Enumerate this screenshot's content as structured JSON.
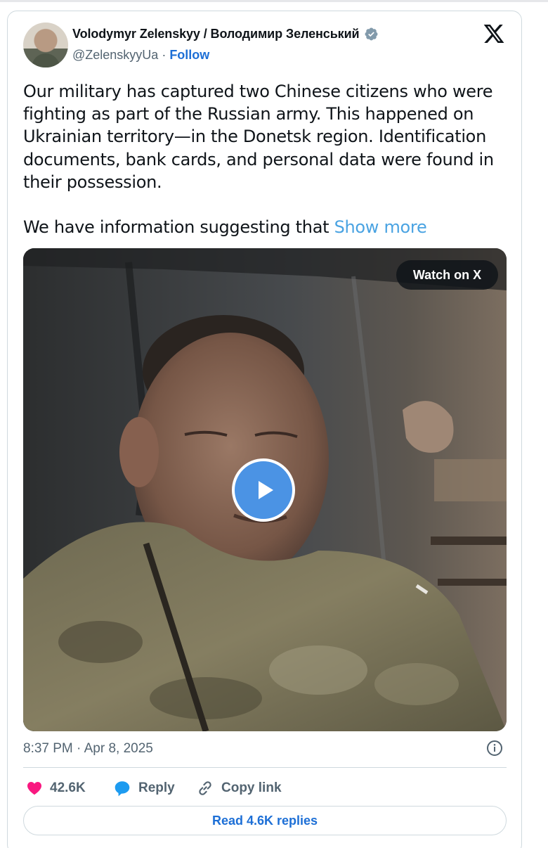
{
  "author": {
    "display_name": "Volodymyr Zelenskyy / Володимир Зеленський",
    "handle": "@ZelenskyyUa",
    "separator": "·",
    "follow_label": "Follow"
  },
  "tweet": {
    "paragraph_1": "Our military has captured two Chinese citizens who were\nfighting as part of the Russian army. This happened on\nUkrainian territory—in the Donetsk region. Identification\ndocuments, bank cards, and personal data were found in\ntheir possession.",
    "paragraph_2": "We have information suggesting that ",
    "show_more_label": "Show more"
  },
  "media": {
    "watch_label": "Watch on X"
  },
  "meta": {
    "timestamp": "8:37 PM · Apr 8, 2025"
  },
  "actions": {
    "likes": "42.6K",
    "reply_label": "Reply",
    "copy_link_label": "Copy link"
  },
  "replies_button_label": "Read 4.6K replies",
  "icons": {
    "verified": "verified-badge-icon",
    "platform": "x-logo-icon",
    "info": "info-icon",
    "like": "heart-icon",
    "reply": "speech-bubble-icon",
    "copy": "link-icon",
    "play": "play-icon"
  },
  "colors": {
    "link": "#1d6fd6",
    "show_more": "#4aa3e2",
    "heart": "#f91880",
    "reply_icon": "#1d9bf0",
    "play_button": "#4b93e4",
    "border": "#cfd9de",
    "secondary_text": "#536471"
  }
}
